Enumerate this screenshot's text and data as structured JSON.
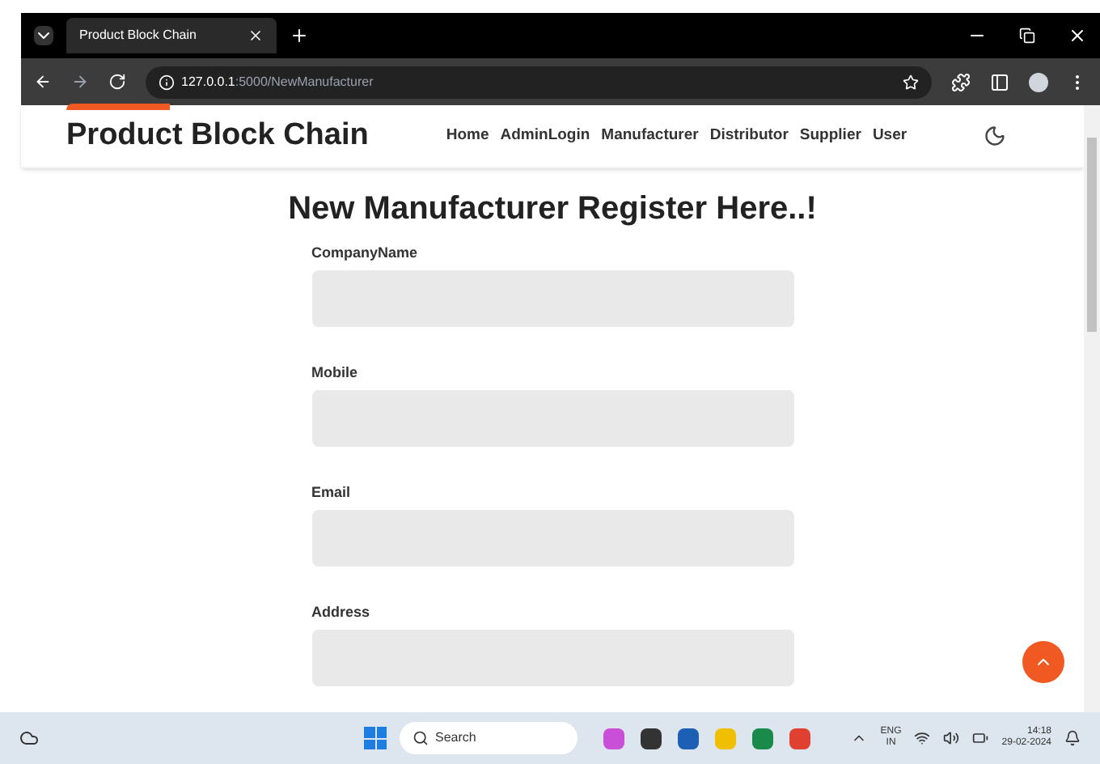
{
  "browser": {
    "tab_title": "Product Block Chain",
    "url_host": "127.0.0.1",
    "url_path": ":5000/NewManufacturer"
  },
  "navbar": {
    "brand": "Product Block Chain",
    "links": [
      "Home",
      "AdminLogin",
      "Manufacturer",
      "Distributor",
      "Supplier",
      "User"
    ]
  },
  "form": {
    "heading": "New Manufacturer Register Here..!",
    "fields": [
      {
        "label": "CompanyName"
      },
      {
        "label": "Mobile"
      },
      {
        "label": "Email"
      },
      {
        "label": "Address"
      }
    ]
  },
  "taskbar": {
    "search_placeholder": "Search",
    "language": "ENG",
    "region": "IN",
    "time": "14:18",
    "date": "29-02-2024"
  }
}
